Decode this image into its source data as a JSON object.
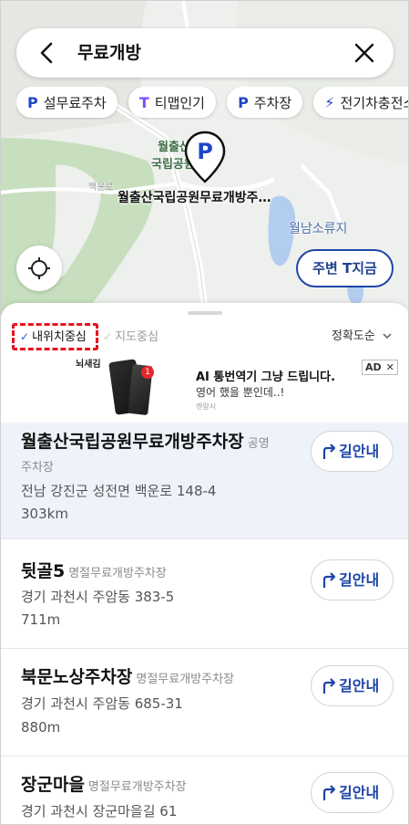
{
  "search": {
    "query": "무료개방"
  },
  "chips": [
    {
      "icon": "P",
      "label": "설무료주차",
      "color": "#1e47c8"
    },
    {
      "icon": "T",
      "label": "티맵인기",
      "color": "#7b4dff"
    },
    {
      "icon": "P",
      "label": "주차장",
      "color": "#1e47c8"
    },
    {
      "icon": "⚡",
      "label": "전기차충전소",
      "color": "#1e47c8"
    }
  ],
  "map": {
    "park_label_1": "월출산",
    "park_label_2": "국립공원",
    "road_label": "백운로",
    "water_label": "월남소류지",
    "pin_label": "월출산국립공원무료개방주…",
    "pin_letter": "P",
    "t_now_label": "주변 T지금"
  },
  "sort": {
    "mine": "내위치중심",
    "map": "지도중심",
    "order": "정확도순"
  },
  "ad": {
    "brand": "뇌새김",
    "headline": "AI 통번역기 그냥 드립니다.",
    "sub": "영어 했을 뿐인데..!",
    "sponsor": "엔랑시",
    "tag": "AD",
    "close": "✕",
    "badge": "1"
  },
  "results": [
    {
      "name": "월출산국립공원무료개방주차장",
      "category": "공영",
      "category2": "주차장",
      "address": "전남 강진군 성전면 백운로 148-4",
      "distance": "303km",
      "nav": "길안내"
    },
    {
      "name": "뒷골5",
      "category": "명절무료개방주차장",
      "address": "경기 과천시 주암동 383-5",
      "distance": "711m",
      "nav": "길안내"
    },
    {
      "name": "북문노상주차장",
      "category": "명절무료개방주차장",
      "address": "경기 과천시 주암동 685-31",
      "distance": "880m",
      "nav": "길안내"
    },
    {
      "name": "장군마을",
      "category": "명절무료개방주차장",
      "address": "경기 과천시 장군마을길 61",
      "distance": "",
      "nav": "길안내"
    }
  ]
}
